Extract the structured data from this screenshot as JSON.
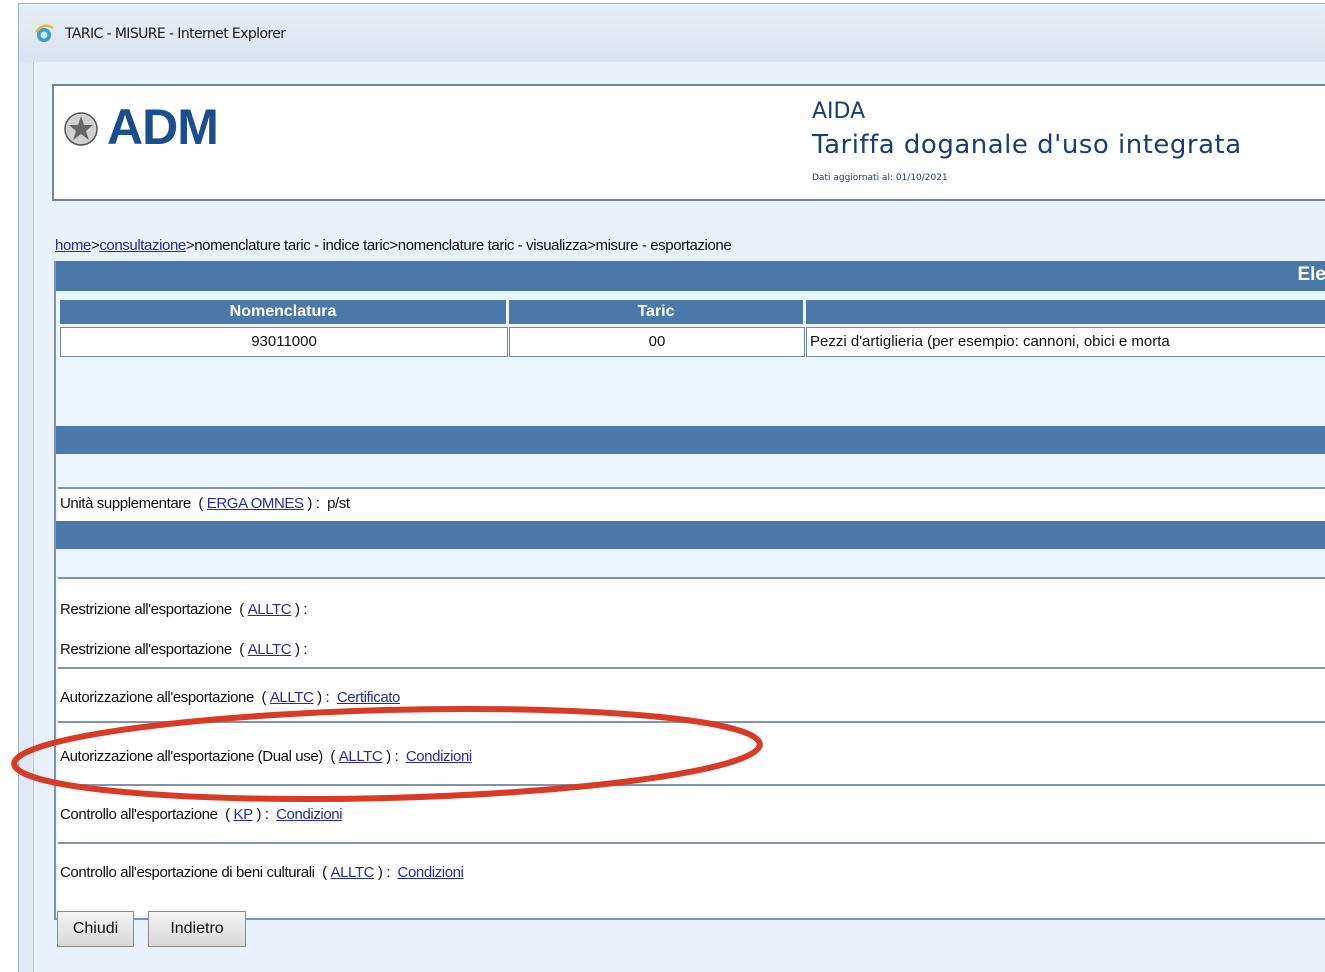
{
  "window": {
    "title": "TARIC - MISURE - Internet Explorer"
  },
  "header": {
    "logo_text": "ADM",
    "app_name": "AIDA",
    "app_subtitle": "Tariffa doganale d'uso integrata",
    "updated": "Dati aggiornati al: 01/10/2021"
  },
  "breadcrumb": {
    "home": "home",
    "sep1": ">",
    "consultazione": "consultazione",
    "rest": ">nomenclature taric - indice taric>nomenclature taric - visualizza>misure - esportazione"
  },
  "section_title": "Ele",
  "nomenclature": {
    "headers": [
      "Nomenclatura",
      "Taric"
    ],
    "code": "93011000",
    "taric": "00",
    "description": "Pezzi d'artiglieria (per esempio: cannoni, obici e morta"
  },
  "supplementary": {
    "label": "Unità supplementare",
    "open": "(",
    "link": "ERGA OMNES",
    "close": ") :",
    "value": "p/st"
  },
  "measures": [
    {
      "label": "Restrizione all'esportazione",
      "link": "ALLTC",
      "action": ""
    },
    {
      "label": "Restrizione all'esportazione",
      "link": "ALLTC",
      "action": ""
    },
    {
      "label": "Autorizzazione all'esportazione",
      "link": "ALLTC",
      "action": "Certificato"
    },
    {
      "label": "Autorizzazione all'esportazione (Dual use)",
      "link": "ALLTC",
      "action": "Condizioni"
    },
    {
      "label": "Controllo all'esportazione",
      "link": "KP",
      "action": "Condizioni"
    },
    {
      "label": "Controllo all'esportazione di beni culturali",
      "link": "ALLTC",
      "action": "Condizioni"
    }
  ],
  "buttons": {
    "close": "Chiudi",
    "back": "Indietro"
  },
  "colors": {
    "accent": "#4a78a9",
    "highlight_ellipse": "#d93a26",
    "link": "#2a2aa0"
  }
}
